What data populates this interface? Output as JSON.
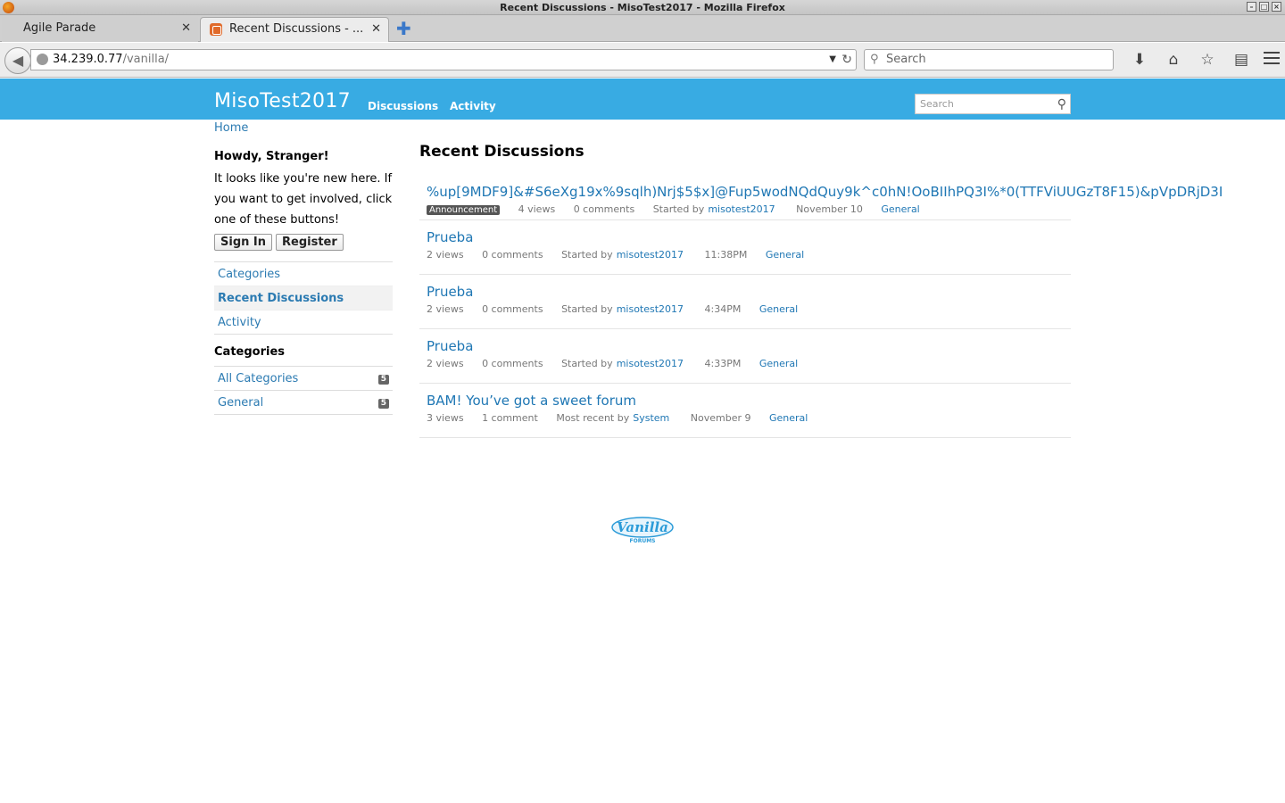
{
  "window": {
    "title": "Recent Discussions - MisoTest2017 - Mozilla Firefox"
  },
  "tabs": [
    {
      "label": "Agile Parade"
    },
    {
      "label": "Recent Discussions - ..."
    }
  ],
  "address": {
    "host": "34.239.0.77",
    "path": "/vanilla/"
  },
  "browser_search": {
    "placeholder": "Search"
  },
  "site": {
    "brand": "MisoTest2017",
    "menu": [
      "Discussions",
      "Activity"
    ],
    "search_placeholder": "Search",
    "accent_color": "#38abe3"
  },
  "breadcrumb": "Home",
  "sidebar": {
    "greeting": "Howdy, Stranger!",
    "intro": "It looks like you're new here. If you want to get involved, click one of these buttons!",
    "sign_in": "Sign In",
    "register": "Register",
    "nav": [
      "Categories",
      "Recent Discussions",
      "Activity"
    ],
    "categories_heading": "Categories",
    "categories": [
      {
        "name": "All Categories",
        "count": "5"
      },
      {
        "name": "General",
        "count": "5"
      }
    ]
  },
  "main": {
    "title": "Recent Discussions",
    "discussions": [
      {
        "title": "%up[9MDF9]&#S6eXg19x%9sqlh)Nrj$5$x]@Fup5wodNQdQuy9k^c0hN!OoBIIhPQ3I%*0(TTFViUUGzT8F15)&pVpDRjD3I",
        "badge": "Announcement",
        "views": "4 views",
        "comments": "0 comments",
        "started_label": "Started by",
        "author": "misotest2017",
        "date": "November 10",
        "category": "General"
      },
      {
        "title": "Prueba",
        "views": "2 views",
        "comments": "0 comments",
        "started_label": "Started by",
        "author": "misotest2017",
        "date": "11:38PM",
        "category": "General"
      },
      {
        "title": "Prueba",
        "views": "2 views",
        "comments": "0 comments",
        "started_label": "Started by",
        "author": "misotest2017",
        "date": "4:34PM",
        "category": "General"
      },
      {
        "title": "Prueba",
        "views": "2 views",
        "comments": "0 comments",
        "started_label": "Started by",
        "author": "misotest2017",
        "date": "4:33PM",
        "category": "General"
      },
      {
        "title": "BAM! You’ve got a sweet forum",
        "views": "3 views",
        "comments": "1 comment",
        "started_label": "Most recent by",
        "author": "System",
        "date": "November 9",
        "category": "General"
      }
    ]
  },
  "footer": {
    "logo_text": "Vanilla",
    "logo_sub": "FORUMS"
  }
}
